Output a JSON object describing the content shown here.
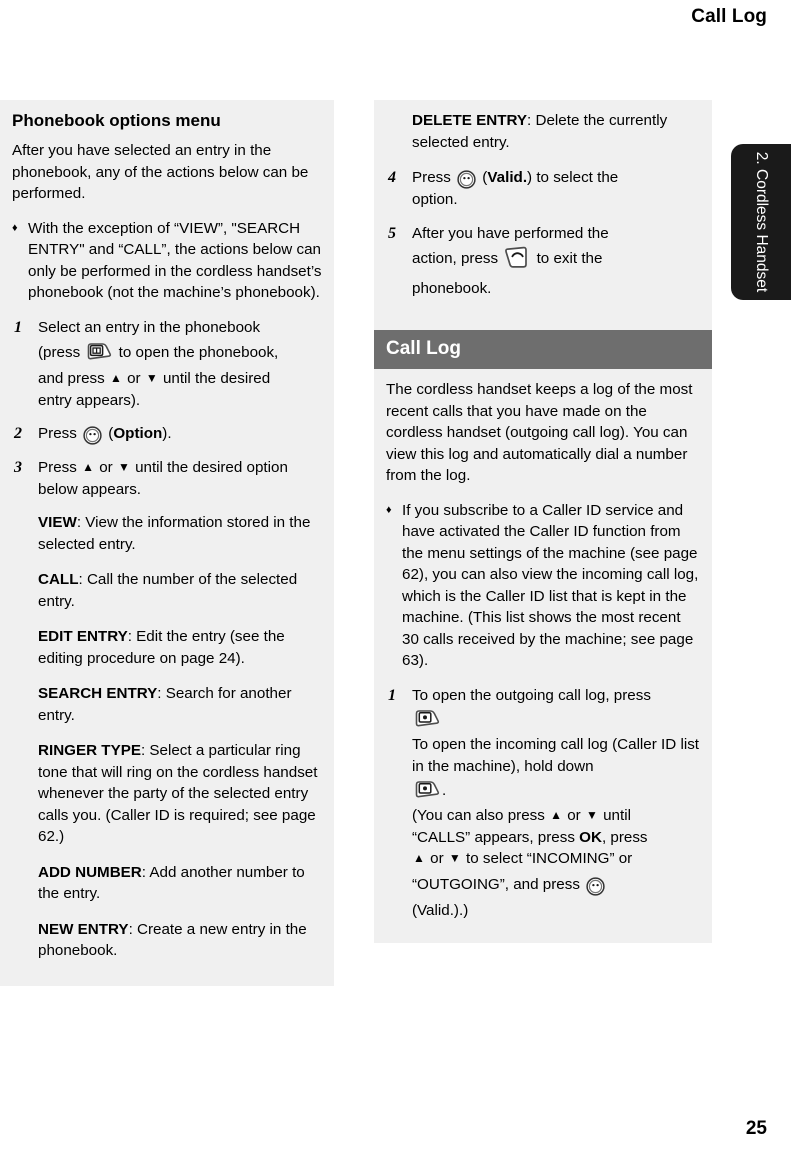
{
  "page": {
    "running_head": "Call Log",
    "folio": "25",
    "thumb_tab": "2. Cordless Handset",
    "band_color": "#6e6e6e",
    "column_bg": "#f0f0f0",
    "tab_bg": "#1a1a1a"
  },
  "left_column": {
    "section_title": "Phonebook options menu",
    "intro": "After you have selected an entry in the phonebook, any of the actions below can be performed.",
    "bullet": {
      "marker": "♦",
      "text": "With the exception of “VIEW”, \"SEARCH ENTRY\" and  “CALL”, the actions below can only be performed in the cordless handset’s phonebook (not the machine’s phonebook)."
    },
    "steps": [
      {
        "num": "1",
        "line1": "Select an entry in the phonebook",
        "line2_a": "(press",
        "icon": "phonebook-key-icon",
        "line2_b": "to open the phonebook,",
        "line3_a": "and press",
        "arrow_up": "▲",
        "or": "or",
        "arrow_down": "▼",
        "line3_b": "until the desired",
        "line4": "entry appears)."
      },
      {
        "num": "2",
        "line1_a": "Press",
        "icon": "valid-button-icon",
        "line1_b": "(",
        "label": "Option",
        "line1_c": ")."
      },
      {
        "num": "3",
        "line1_a": "Press",
        "arrow_up": "▲",
        "or": "or",
        "arrow_down": "▼",
        "line1_b": "until the desired option",
        "line2": "below appears."
      }
    ],
    "options": [
      {
        "name": "VIEW",
        "desc": ": View the information stored in the selected entry."
      },
      {
        "name": "CALL",
        "desc": ": Call the number of the selected entry."
      },
      {
        "name": "EDIT ENTRY",
        "desc": ": Edit the entry (see the editing procedure on page 24)."
      },
      {
        "name": "SEARCH ENTRY",
        "desc": ": Search for another entry."
      },
      {
        "name": "RINGER TYPE",
        "desc": ": Select a particular ring tone that will ring on the cordless handset whenever the party of the selected entry calls you. (Caller ID is required; see page 62.)"
      },
      {
        "name": "ADD NUMBER",
        "desc": ": Add another number to the entry."
      },
      {
        "name": "NEW ENTRY",
        "desc": ": Create a new entry in the phonebook."
      }
    ]
  },
  "right_column": {
    "options_continued": [
      {
        "name": "DELETE ENTRY",
        "desc": ": Delete the currently selected entry."
      }
    ],
    "steps": [
      {
        "num": "4",
        "line1_a": "Press",
        "icon": "valid-button-icon",
        "line1_b": "(",
        "label": "Valid.",
        "line1_c": ") to select the",
        "line2": "option."
      },
      {
        "num": "5",
        "line1": "After you have performed the",
        "line2_a": "action, press",
        "icon": "hangup-key-icon",
        "line2_b": "to exit the",
        "line3": "phonebook."
      }
    ],
    "section_title": "Call Log",
    "intro": "The cordless handset keeps a log of the most recent calls that you have made on the cordless handset (outgoing call log). You can view this log and automatically dial a number from the log.",
    "bullet": {
      "marker": "♦",
      "text": "If you subscribe to a Caller ID service and have activated the Caller ID function from the menu settings of the machine (see page 62), you can also view the incoming call log, which is the Caller ID list that is kept in the machine. (This list shows the most recent 30 calls received by the machine; see page 63)."
    },
    "step1": {
      "num": "1",
      "line1": "To open the outgoing call log, press",
      "icon1": "call-log-key-icon",
      "line2": "To open the incoming call log (Caller ID list in the machine), hold down",
      "icon2": "call-log-key-icon",
      "line3_period": ".",
      "note_a": "(You can also press",
      "arrow_up": "▲",
      "or": "or",
      "arrow_down": "▼",
      "note_b": "until",
      "note_c": "“CALLS” appears, press",
      "ok_label": "OK",
      "note_d": ", press",
      "note_e": "to select “INCOMING” or",
      "note_f": "“OUTGOING”, and press",
      "icon3": "valid-button-icon",
      "note_g": "(Valid.).)"
    }
  }
}
